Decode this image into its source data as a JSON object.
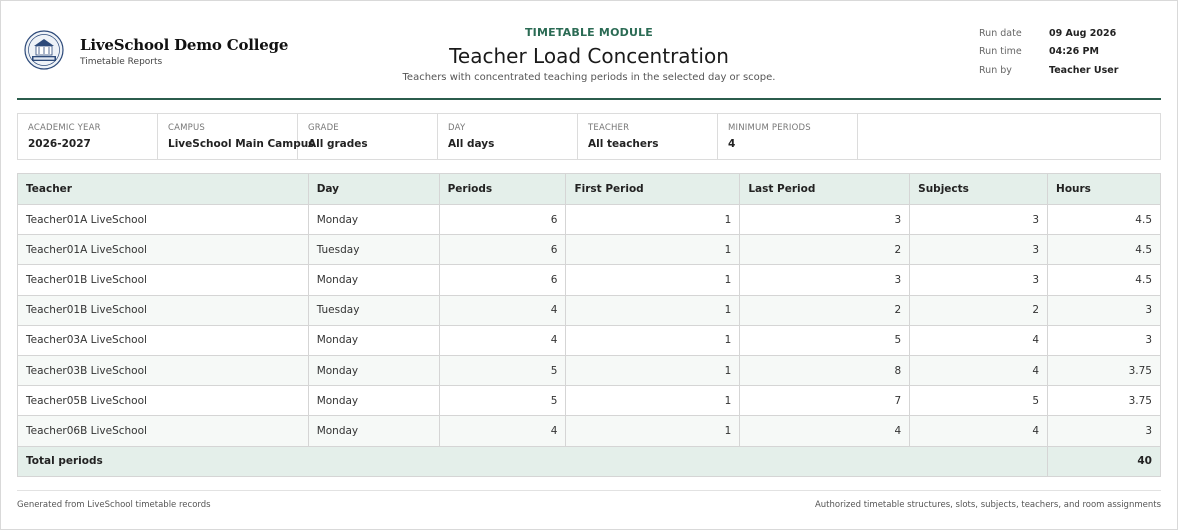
{
  "header": {
    "college_name": "LiveSchool Demo College",
    "college_subtitle": "Timetable Reports",
    "module": "TIMETABLE MODULE",
    "title": "Teacher Load Concentration",
    "subtitle": "Teachers with concentrated teaching periods in the selected day or scope.",
    "run_date_label": "Run date",
    "run_date": "09 Aug 2026",
    "run_time_label": "Run time",
    "run_time": "04:26 PM",
    "run_by_label": "Run by",
    "run_by": "Teacher User"
  },
  "filters": [
    {
      "label": "ACADEMIC YEAR",
      "value": "2026-2027"
    },
    {
      "label": "CAMPUS",
      "value": "LiveSchool Main Campus"
    },
    {
      "label": "GRADE",
      "value": "All grades"
    },
    {
      "label": "DAY",
      "value": "All days"
    },
    {
      "label": "TEACHER",
      "value": "All teachers"
    },
    {
      "label": "MINIMUM PERIODS",
      "value": "4"
    }
  ],
  "table": {
    "columns": [
      "Teacher",
      "Day",
      "Periods",
      "First Period",
      "Last Period",
      "Subjects",
      "Hours"
    ],
    "rows": [
      [
        "Teacher01A LiveSchool",
        "Monday",
        "6",
        "1",
        "3",
        "3",
        "4.5"
      ],
      [
        "Teacher01A LiveSchool",
        "Tuesday",
        "6",
        "1",
        "2",
        "3",
        "4.5"
      ],
      [
        "Teacher01B LiveSchool",
        "Monday",
        "6",
        "1",
        "3",
        "3",
        "4.5"
      ],
      [
        "Teacher01B LiveSchool",
        "Tuesday",
        "4",
        "1",
        "2",
        "2",
        "3"
      ],
      [
        "Teacher03A LiveSchool",
        "Monday",
        "4",
        "1",
        "5",
        "4",
        "3"
      ],
      [
        "Teacher03B LiveSchool",
        "Monday",
        "5",
        "1",
        "8",
        "4",
        "3.75"
      ],
      [
        "Teacher05B LiveSchool",
        "Monday",
        "5",
        "1",
        "7",
        "5",
        "3.75"
      ],
      [
        "Teacher06B LiveSchool",
        "Monday",
        "4",
        "1",
        "4",
        "4",
        "3"
      ]
    ],
    "total_label": "Total periods",
    "total_value": "40"
  },
  "footer": {
    "left": "Generated from LiveSchool timetable records",
    "right": "Authorized timetable structures, slots, subjects, teachers, and room assignments"
  },
  "colors": {
    "accent": "#2b6b54",
    "rule": "#2b5c4c",
    "header_bg": "#e4efea"
  },
  "icons": {
    "logo": "school-crest-icon"
  }
}
